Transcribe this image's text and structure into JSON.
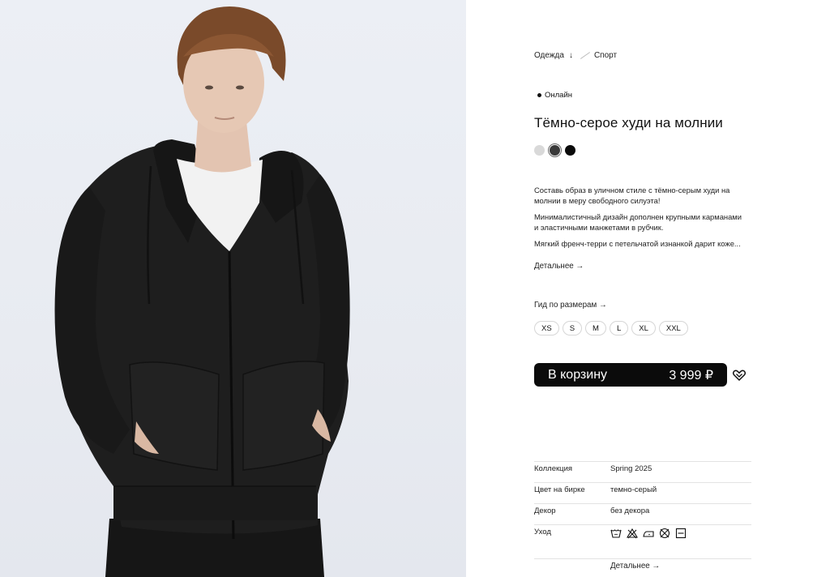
{
  "breadcrumbs": [
    {
      "label": "Одежда",
      "arrow": "↓"
    },
    {
      "label": "Спорт"
    }
  ],
  "availability_badge": "Онлайн",
  "product": {
    "title": "Тёмно-серое худи на молнии",
    "colors": [
      {
        "name": "light-gray",
        "hex": "#d9d9d9"
      },
      {
        "name": "charcoal",
        "hex": "#3a3a3a",
        "selected": true
      },
      {
        "name": "black",
        "hex": "#0a0a0a"
      }
    ],
    "description": [
      "Составь образ в уличном стиле с тёмно-серым худи на молнии в меру свободного силуэта!",
      "Минималистичный дизайн дополнен крупными карманами и эластичными манжетами в рубчик.",
      "Мягкий френч-терри с петельчатой изнанкой дарит коже..."
    ],
    "more_label": "Детальнее →",
    "size_guide_label": "Гид по размерам →",
    "sizes": [
      "XS",
      "S",
      "M",
      "L",
      "XL",
      "XXL"
    ],
    "cart_label": "В корзину",
    "price": "3 999 ₽"
  },
  "specs": [
    {
      "key": "Коллекция",
      "value": "Spring 2025"
    },
    {
      "key": "Цвет на бирке",
      "value": "темно-серый"
    },
    {
      "key": "Декор",
      "value": "без декора"
    },
    {
      "key": "Уход",
      "value": ""
    }
  ],
  "care_icons": [
    "wash-30-icon",
    "no-bleach-icon",
    "iron-low-icon",
    "no-tumble-dry-icon",
    "dry-flat-icon"
  ],
  "specs_more_label": "Детальнее →"
}
